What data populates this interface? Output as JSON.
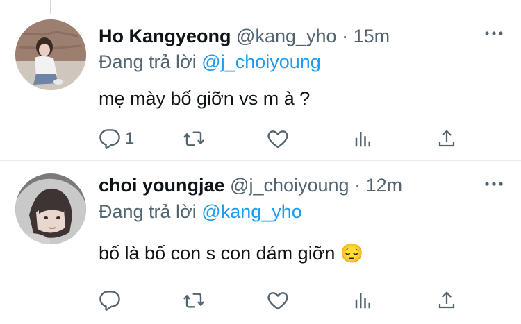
{
  "tweets": [
    {
      "display_name": "Ho Kangyeong",
      "handle": "@kang_yho",
      "separator": "·",
      "time": "15m",
      "reply_prefix": "Đang trả lời",
      "reply_to": "@j_choiyoung",
      "text": "mẹ mày bố giỡn vs m à ?",
      "reply_count": "1",
      "avatar": "photo of woman crouching outdoors"
    },
    {
      "display_name": "choi youngjae",
      "handle": "@j_choiyoung",
      "separator": "·",
      "time": "12m",
      "reply_prefix": "Đang trả lời",
      "reply_to": "@kang_yho",
      "text": "bố là bố con s con dám giỡn 😔",
      "reply_count": "",
      "avatar": "selfie of young man in hoodie"
    }
  ],
  "icons": {
    "more": "more-horizontal-icon",
    "reply": "reply-icon",
    "retweet": "retweet-icon",
    "like": "heart-icon",
    "analytics": "analytics-icon",
    "share": "share-icon"
  },
  "colors": {
    "text": "#0f1419",
    "secondary": "#536471",
    "link": "#1d9bf0",
    "divider": "#e6ecf0"
  }
}
